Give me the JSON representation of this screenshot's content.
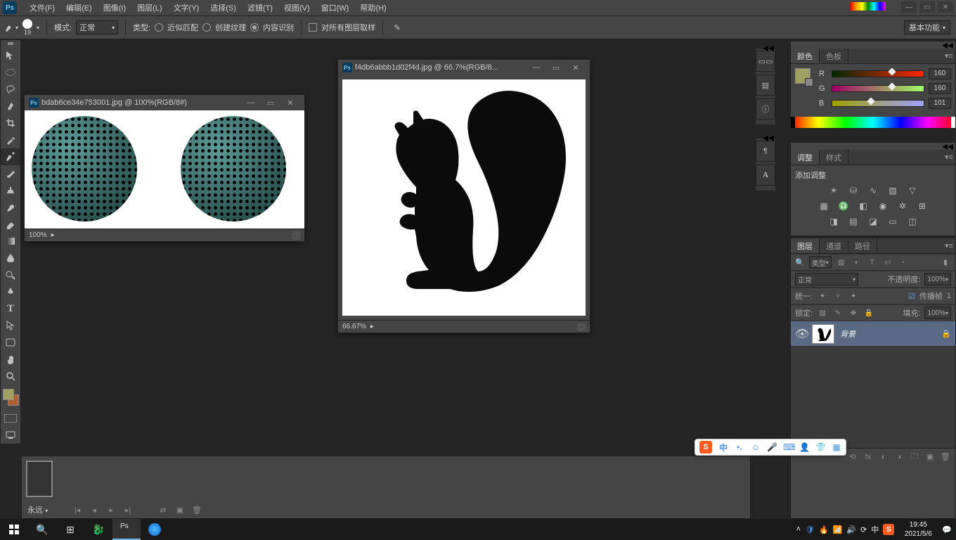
{
  "app": {
    "logo": "Ps"
  },
  "menu": {
    "file": "文件(F)",
    "edit": "编辑(E)",
    "image": "图像(I)",
    "layer": "图层(L)",
    "type": "文字(Y)",
    "select": "选择(S)",
    "filter": "滤镜(T)",
    "view": "视图(V)",
    "window": "窗口(W)",
    "help": "帮助(H)"
  },
  "options": {
    "brush_size": "19",
    "mode_label": "模式:",
    "mode_value": "正常",
    "type_label": "类型:",
    "approx_match": "近似匹配",
    "create_texture": "创建纹理",
    "content_aware": "内容识别",
    "sample_all": "对所有图层取样",
    "workspace": "基本功能"
  },
  "doc1": {
    "title": "bdab6ce34e753001.jpg @ 100%(RGB/8#)",
    "zoom": "100%"
  },
  "doc2": {
    "title": "f4db6abbb1d02f4d.jpg @ 66.7%(RGB/8...",
    "zoom": "66.67%"
  },
  "panels": {
    "color_tab": "颜色",
    "swatches_tab": "色板",
    "r_label": "R",
    "g_label": "G",
    "b_label": "B",
    "r_val": "160",
    "g_val": "160",
    "b_val": "101",
    "adjust_tab": "调整",
    "styles_tab": "样式",
    "add_adjust": "添加调整",
    "layers_tab": "图层",
    "channels_tab": "通道",
    "paths_tab": "路径",
    "kind_label": "类型",
    "blend_mode": "正常",
    "opacity_label": "不透明度:",
    "opacity_val": "100%",
    "unify_label": "统一:",
    "propagate_label": "传播帧",
    "propagate_val": "1",
    "lock_label": "锁定:",
    "fill_label": "填充:",
    "fill_val": "100%",
    "layer_bg": "背景"
  },
  "dock": {
    "icon_A": "A"
  },
  "timeline": {
    "forever": "永远"
  },
  "taskbar": {
    "ime_zh": "中",
    "time": "19:45",
    "date": "2021/5/6"
  }
}
